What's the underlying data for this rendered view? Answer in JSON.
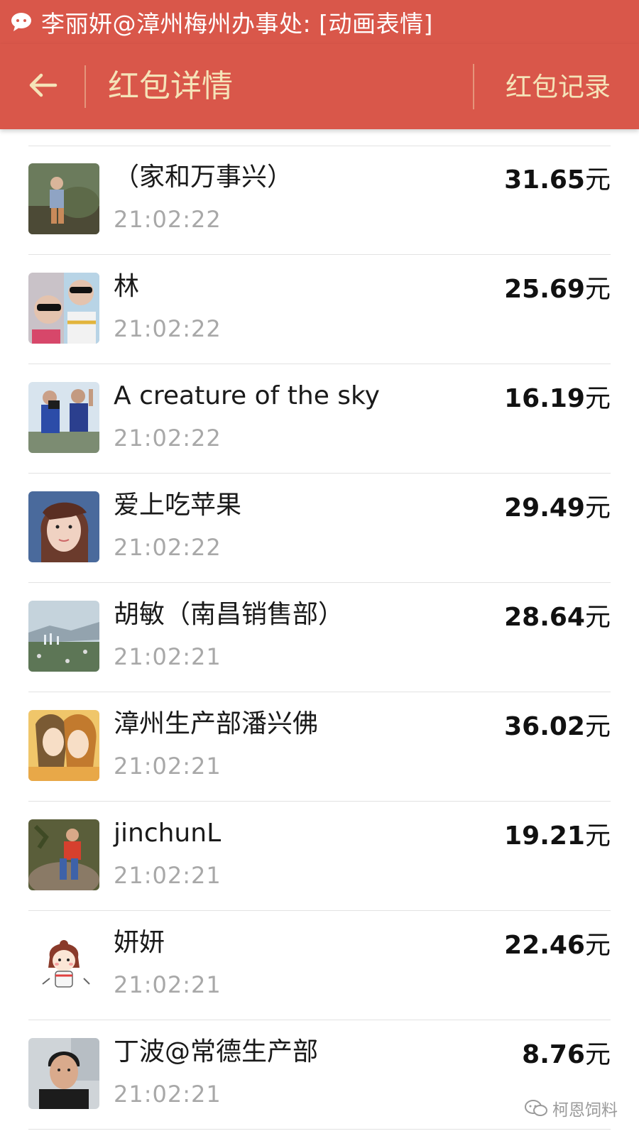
{
  "status_bar": {
    "notification": "李丽妍@漳州梅州办事处: [动画表情]",
    "icon": "wechat-icon"
  },
  "header": {
    "back_icon": "back-arrow-icon",
    "title": "红包详情",
    "records_link": "红包记录"
  },
  "colors": {
    "header_bg": "#d9574a",
    "header_text": "#f5e3b8",
    "time_text": "#a8a8a8",
    "divider": "#e2e2e2"
  },
  "currency_unit": "元",
  "list": [
    {
      "name": "（家和万事兴）",
      "time": "21:02:22",
      "amount": "31.65"
    },
    {
      "name": "林",
      "time": "21:02:22",
      "amount": "25.69"
    },
    {
      "name": "A creature of the sky",
      "time": "21:02:22",
      "amount": "16.19"
    },
    {
      "name": "爱上吃苹果",
      "time": "21:02:22",
      "amount": "29.49"
    },
    {
      "name": "胡敏（南昌销售部）",
      "time": "21:02:21",
      "amount": "28.64"
    },
    {
      "name": "漳州生产部潘兴佛",
      "time": "21:02:21",
      "amount": "36.02"
    },
    {
      "name": "jinchunL",
      "time": "21:02:21",
      "amount": "19.21"
    },
    {
      "name": "妍妍",
      "time": "21:02:21",
      "amount": "22.46"
    },
    {
      "name": "丁波@常德生产部",
      "time": "21:02:21",
      "amount": "8.76"
    }
  ],
  "watermark": {
    "icon": "wechat-icon",
    "text": "柯恩饲料"
  }
}
